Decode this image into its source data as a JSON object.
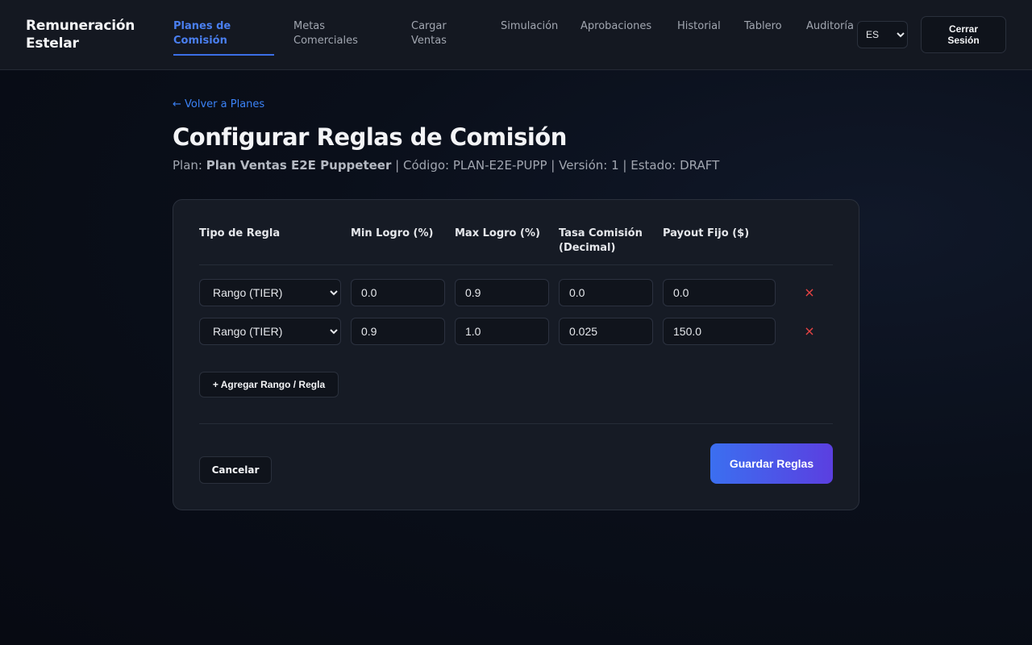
{
  "app": {
    "brand": "Remuneración Estelar"
  },
  "nav": {
    "items": [
      {
        "label": "Planes de Comisión",
        "active": true
      },
      {
        "label": "Metas Comerciales",
        "active": false
      },
      {
        "label": "Cargar Ventas",
        "active": false
      },
      {
        "label": "Simulación",
        "active": false
      },
      {
        "label": "Aprobaciones",
        "active": false
      },
      {
        "label": "Historial",
        "active": false
      },
      {
        "label": "Tablero",
        "active": false
      },
      {
        "label": "Auditoría",
        "active": false
      }
    ],
    "language": {
      "selected": "ES",
      "options": [
        "ES"
      ]
    },
    "logout_label": "Cerrar Sesión"
  },
  "header": {
    "back_link": "← Volver a Planes",
    "title": "Configurar Reglas de Comisión",
    "plan_label": "Plan:",
    "plan_name": "Plan Ventas E2E Puppeteer",
    "plan_rest": "| Código: PLAN-E2E-PUPP | Versión: 1 | Estado: DRAFT"
  },
  "table": {
    "columns": [
      "Tipo de Regla",
      "Min Logro (%)",
      "Max Logro (%)",
      "Tasa Comisión (Decimal)",
      "Payout Fijo ($)"
    ],
    "rule_type_options": [
      "Rango (TIER)"
    ],
    "rows": [
      {
        "type": "Rango (TIER)",
        "min": "0.0",
        "max": "0.9",
        "rate": "0.0",
        "payout": "0.0",
        "remove": "×"
      },
      {
        "type": "Rango (TIER)",
        "min": "0.9",
        "max": "1.0",
        "rate": "0.025",
        "payout": "150.0",
        "remove": "×"
      }
    ]
  },
  "actions": {
    "add_label": "+ Agregar Rango / Regla",
    "cancel_label": "Cancelar",
    "save_label": "Guardar Reglas"
  },
  "colors": {
    "accent": "#3b82f6",
    "danger": "#ef4444",
    "background": "#070a12",
    "card": "#161b25",
    "save_gradient_start": "#3b6ff0",
    "save_gradient_end": "#5b3fe0"
  }
}
